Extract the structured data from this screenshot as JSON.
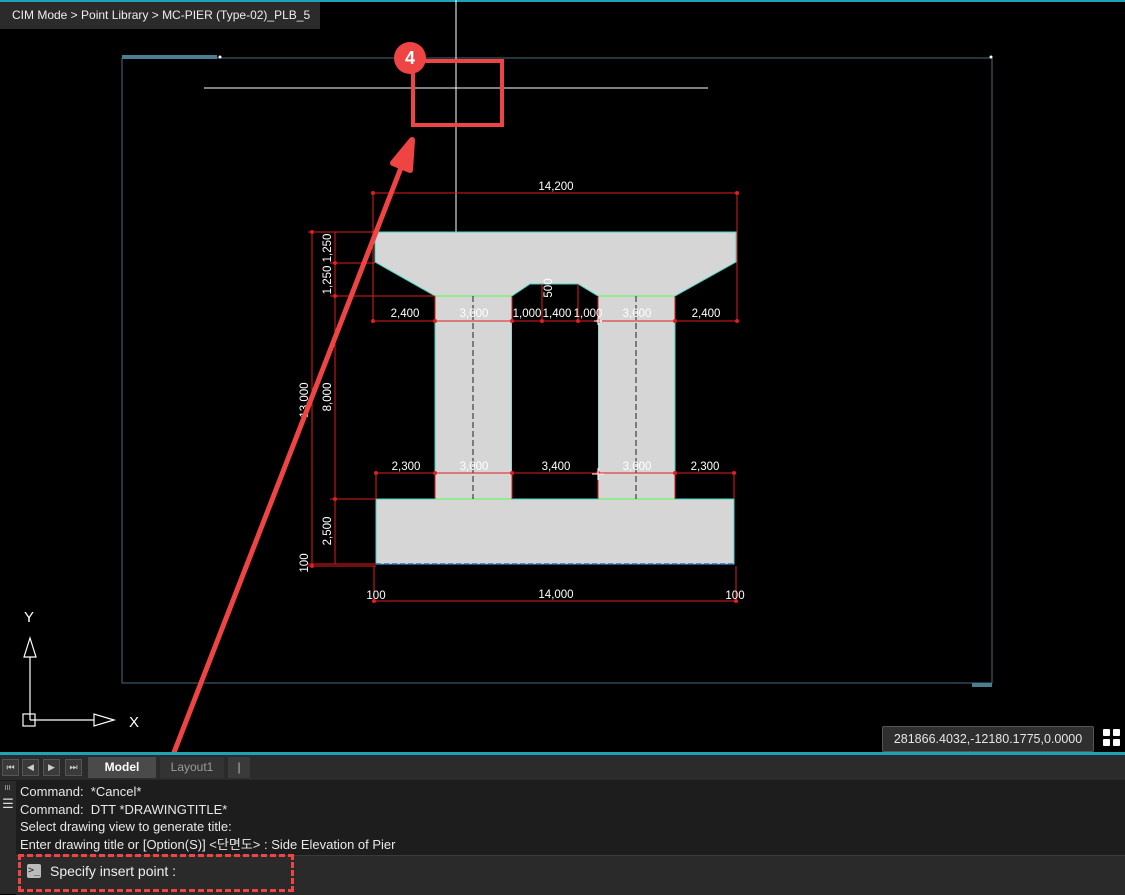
{
  "breadcrumb": "CIM Mode > Point Library > MC-PIER (Type-02)_PLB_5",
  "drawing": {
    "top_width": "14,200",
    "left_vertical": {
      "overall": "13,000",
      "cap_a": "1,250",
      "cap_b": "1,250",
      "column": "8,000",
      "footing": "2,500",
      "bottom": "100"
    },
    "cap_notch": "500",
    "cap_row": [
      "2,400",
      "3,000",
      "1,000",
      "1,400",
      "1,000",
      "3,000",
      "2,400"
    ],
    "lower_row": [
      "2,300",
      "3,000",
      "3,400",
      "3,000",
      "2,300"
    ],
    "bottom_width": "14,000",
    "bottom_left": "100",
    "bottom_right": "100"
  },
  "ucs": {
    "y_label": "Y",
    "x_label": "X"
  },
  "coordinates": "281866.4032,-12180.1775,0.0000",
  "tabs": {
    "model": "Model",
    "layout": "Layout1",
    "extra": "|"
  },
  "nav": {
    "first": "⏮",
    "prev": "◀",
    "next": "▶",
    "last": "⏭"
  },
  "command_history": [
    "Command:  *Cancel*",
    "Command:  DTT *DRAWINGTITLE*",
    "Select drawing view to generate title:",
    "Enter drawing title or [Option(S)] <단면도> : Side Elevation of Pier"
  ],
  "command_prompt": "Specify insert point :",
  "annotation": {
    "step": "4",
    "color": "#ef4444"
  },
  "colors": {
    "accent": "#1fa3b4",
    "dimension": "#e01e1e",
    "pier_fill": "#d6d6d6"
  }
}
